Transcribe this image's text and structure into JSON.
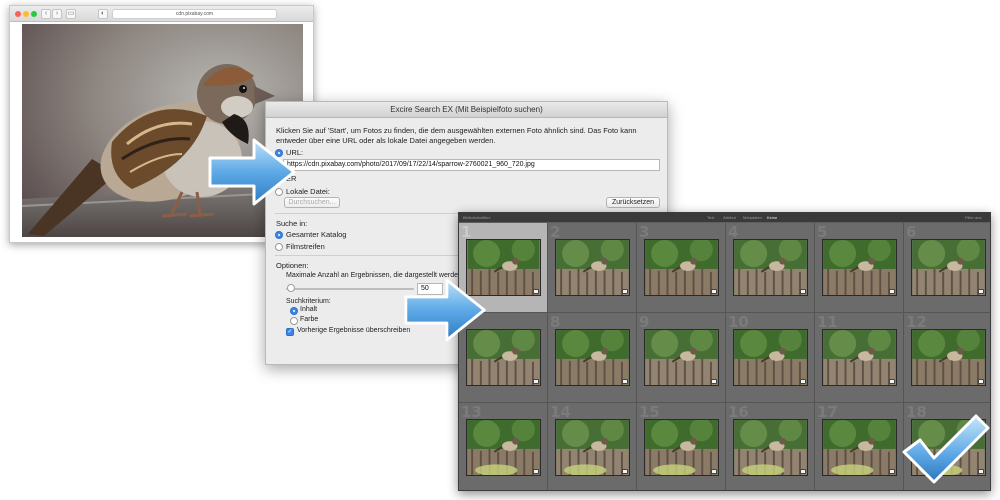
{
  "browser": {
    "url": "cdn.pixabay.com",
    "back_glyph": "‹",
    "forward_glyph": "›",
    "sidebar_glyph": "▭",
    "reader_glyph": "◐"
  },
  "dialog": {
    "title": "Excire Search EX (Mit Beispielfoto suchen)",
    "intro": "Klicken Sie auf 'Start', um Fotos zu finden, die dem ausgewählten externen Foto ähnlich sind. Das Foto kann entweder über eine URL oder als lokale Datei angegeben werden.",
    "url_label": "URL:",
    "url_value": "https://cdn.pixabay.com/photo/2017/09/17/22/14/sparrow-2760021_960_720.jpg",
    "or_label": "ER",
    "local_file_label": "Lokale Datei:",
    "browse_button": "Durchsuchen...",
    "reset_button": "Zurücksetzen",
    "search_in_label": "Suche in:",
    "search_in_options": [
      "Gesamter Katalog",
      "Filmstreifen"
    ],
    "options_label": "Optionen:",
    "max_results_label": "Maximale Anzahl an Ergebnissen, die dargestellt werden sollen:",
    "max_results_value": "50",
    "criterion_label": "Suchkriterium:",
    "criterion_options": [
      "Inhalt",
      "Farbe"
    ],
    "overwrite_label": "Vorherige Ergebnisse überschreiben",
    "checkbox_glyph": "✓"
  },
  "lightroom": {
    "bar_left": "Bibliotheksfilter:",
    "bar_tabs": [
      "Text",
      "Attribut",
      "Metadaten",
      "Keine"
    ],
    "bar_active": "Keine",
    "bar_right": "Filter aus",
    "cells": [
      "1",
      "2",
      "3",
      "4",
      "5",
      "6",
      "7",
      "8",
      "9",
      "10",
      "11",
      "12",
      "13",
      "14",
      "15",
      "16",
      "17",
      "18"
    ],
    "selected_index": 0
  },
  "colors": {
    "accent_blue": "#3b86e8",
    "arrow_blue": "#5aa8e8",
    "lr_background": "#5e5e5e"
  }
}
